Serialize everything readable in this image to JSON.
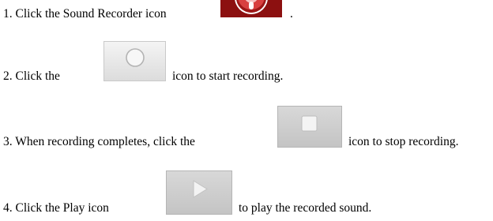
{
  "steps": [
    {
      "before": "1. Click the Sound Recorder icon",
      "after": ".",
      "icon": "sound-recorder-icon"
    },
    {
      "before": "2. Click the",
      "after": "icon to start recording.",
      "icon": "record-circle-icon"
    },
    {
      "before": "3. When recording completes, click the",
      "after": "icon to stop recording.",
      "icon": "stop-square-icon"
    },
    {
      "before": "4. Click the Play icon",
      "after": "to play the recorded sound.",
      "icon": "play-triangle-icon"
    }
  ],
  "colors": {
    "text": "#000000",
    "recorder_bg": "#8c1010",
    "button_bg": "#e6e6e6"
  }
}
